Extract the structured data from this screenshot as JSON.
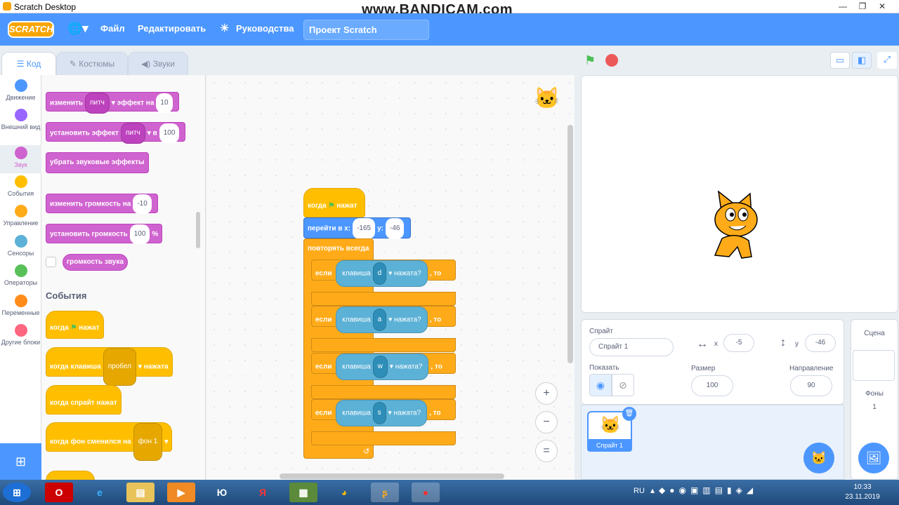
{
  "window": {
    "title": "Scratch Desktop",
    "min": "—",
    "max": "❐",
    "close": "✕"
  },
  "watermark": "www.BANDICAM.com",
  "menubar": {
    "logo": "SCRATCH",
    "file": "Файл",
    "edit": "Редактировать",
    "tutorials": "Руководства",
    "project_title": "Проект Scratch"
  },
  "tabs": {
    "code": "Код",
    "costumes": "Костюмы",
    "sounds": "Звуки"
  },
  "categories": [
    {
      "label": "Движение",
      "color": "#4c97ff"
    },
    {
      "label": "Внешний вид",
      "color": "#9966ff"
    },
    {
      "label": "Звук",
      "color": "#cf63cf"
    },
    {
      "label": "События",
      "color": "#ffbf00"
    },
    {
      "label": "Управление",
      "color": "#ffab19"
    },
    {
      "label": "Сенсоры",
      "color": "#5cb1d6"
    },
    {
      "label": "Операторы",
      "color": "#59c059"
    },
    {
      "label": "Переменные",
      "color": "#ff8c1a"
    },
    {
      "label": "Другие блоки",
      "color": "#ff6680"
    }
  ],
  "palette": {
    "change_effect": {
      "a": "изменить",
      "dd": "питч",
      "b": "эффект на",
      "v": "10"
    },
    "set_effect": {
      "a": "установить эффект",
      "dd": "питч",
      "b": "в",
      "v": "100"
    },
    "clear_effects": "убрать звуковые эффекты",
    "change_volume": {
      "a": "изменить громкость на",
      "v": "-10"
    },
    "set_volume": {
      "a": "установить громкость",
      "v": "100",
      "u": "%"
    },
    "volume": "громкость звука",
    "events_heading": "События",
    "when_flag": {
      "a": "когда",
      "b": "нажат"
    },
    "when_key": {
      "a": "когда клавиша",
      "dd": "пробел",
      "b": "нажата"
    },
    "when_sprite": "когда спрайт нажат",
    "when_backdrop": {
      "a": "когда фон сменился на",
      "dd": "фон 1"
    }
  },
  "script": {
    "hat": {
      "a": "когда",
      "b": "нажат"
    },
    "goto": {
      "a": "перейти в x:",
      "x": "-165",
      "b": "y:",
      "y": "-46"
    },
    "forever": "повторять всегда",
    "ifs": [
      {
        "if": "если",
        "key": "клавиша",
        "k": "d",
        "pressed": "нажата?",
        "then": ", то"
      },
      {
        "if": "если",
        "key": "клавиша",
        "k": "a",
        "pressed": "нажата?",
        "then": ", то"
      },
      {
        "if": "если",
        "key": "клавиша",
        "k": "w",
        "pressed": "нажата?",
        "then": ", то"
      },
      {
        "if": "если",
        "key": "клавиша",
        "k": "s",
        "pressed": "нажата?",
        "then": ", то"
      }
    ]
  },
  "zoom": {
    "in": "+",
    "out": "−",
    "reset": "="
  },
  "sprite_info": {
    "sprite_label": "Спрайт",
    "sprite_name": "Спрайт 1",
    "x_label": "x",
    "x": "-5",
    "y_label": "y",
    "y": "-46",
    "show_label": "Показать",
    "size_label": "Размер",
    "size": "100",
    "direction_label": "Направление",
    "direction": "90"
  },
  "sprite_tile": "Спрайт 1",
  "stage_panel": {
    "title": "Сцена",
    "backdrops_label": "Фоны",
    "backdrops": "1"
  },
  "taskbar": {
    "lang": "RU",
    "time": "10:33",
    "date": "23.11.2019"
  }
}
